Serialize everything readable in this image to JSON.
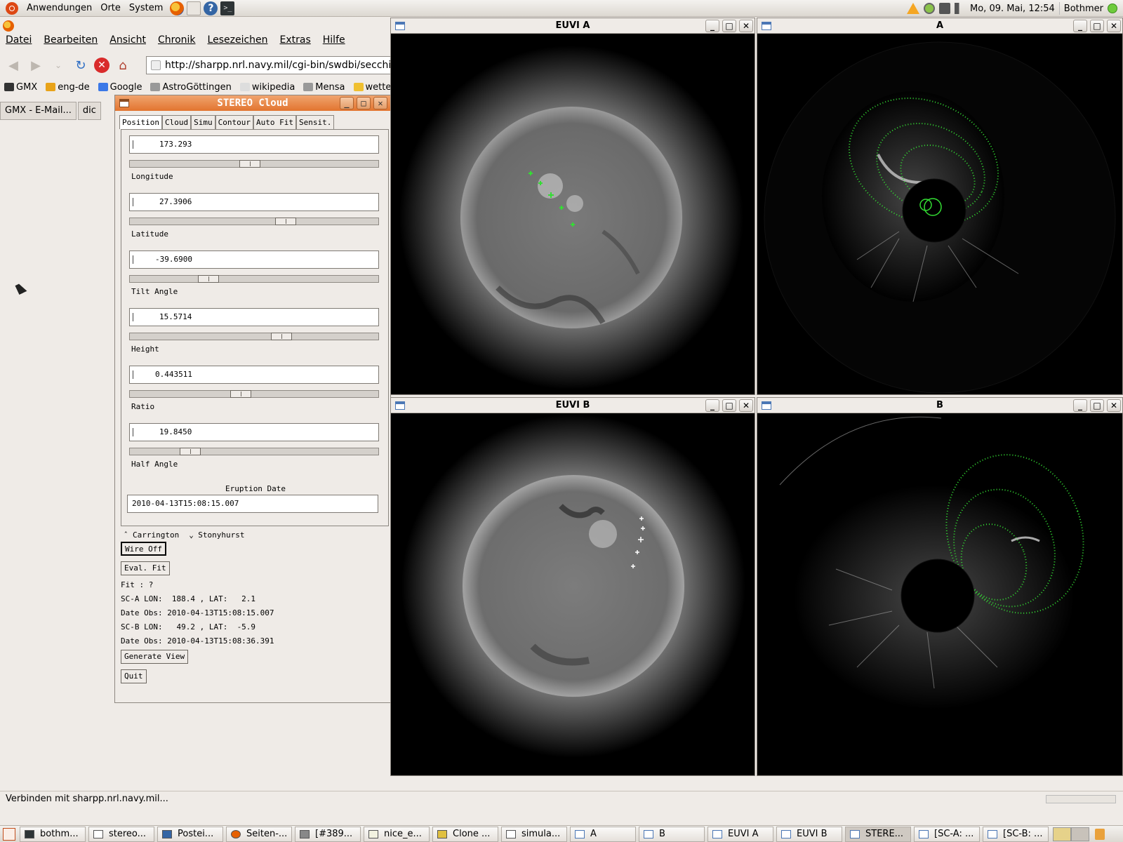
{
  "top_panel": {
    "menus": [
      "Anwendungen",
      "Orte",
      "System"
    ],
    "clock": "Mo, 09. Mai, 12:54",
    "user": "Bothmer"
  },
  "firefox": {
    "menus": [
      "Datei",
      "Bearbeiten",
      "Ansicht",
      "Chronik",
      "Lesezeichen",
      "Extras",
      "Hilfe"
    ],
    "url": "http://sharpp.nrl.navy.mil/cgi-bin/swdbi/secchi_fligh",
    "bookmarks": [
      "GMX",
      "eng-de",
      "Google",
      "AstroGöttingen",
      "wikipedia",
      "Mensa",
      "wette"
    ],
    "tabs": [
      "GMX - E-Mail...",
      "dic"
    ],
    "status": "Verbinden mit sharpp.nrl.navy.mil..."
  },
  "windows": {
    "euvi_a": "EUVI A",
    "cor_a": "A",
    "euvi_b": "EUVI B",
    "cor_b": "B"
  },
  "stereo_cloud": {
    "title": "STEREO Cloud",
    "tabs": [
      "Position",
      "Cloud",
      "Simu",
      "Contour",
      "Auto Fit",
      "Sensit."
    ],
    "params": [
      {
        "label": "Longitude",
        "value": "173.293",
        "slider": 0.48
      },
      {
        "label": "Latitude",
        "value": "27.3906",
        "slider": 0.64
      },
      {
        "label": "Tilt Angle",
        "value": "-39.6900",
        "slider": 0.3
      },
      {
        "label": "Height",
        "value": "15.5714",
        "slider": 0.62
      },
      {
        "label": "Ratio",
        "value": "0.443511",
        "slider": 0.44
      },
      {
        "label": "Half Angle",
        "value": "19.8450",
        "slider": 0.22
      }
    ],
    "eruption_label": "Eruption Date",
    "eruption_date": "2010-04-13T15:08:15.007",
    "radio": {
      "carrington": "Carrington",
      "stonyhurst": "Stonyhurst"
    },
    "buttons": {
      "wire_off": "Wire Off",
      "eval_fit": "Eval. Fit",
      "generate_view": "Generate View",
      "quit": "Quit"
    },
    "info": {
      "fit": "Fit : ?",
      "sca": "SC-A LON:  188.4 , LAT:   2.1",
      "date_a": "Date Obs: 2010-04-13T15:08:15.007",
      "scb": "SC-B LON:   49.2 , LAT:  -5.9",
      "date_b": "Date Obs: 2010-04-13T15:08:36.391"
    }
  },
  "taskbar": [
    "bothm...",
    "stereo...",
    "Postei...",
    "Seiten-...",
    "[#389...",
    "nice_e...",
    "Clone ...",
    "simula...",
    "A",
    "B",
    "EUVI A",
    "EUVI B",
    "STERE...",
    "[SC-A: ...",
    "[SC-B: ..."
  ],
  "colors": {
    "wireframe": "#33dd33",
    "selection_title": "#e67a35"
  }
}
